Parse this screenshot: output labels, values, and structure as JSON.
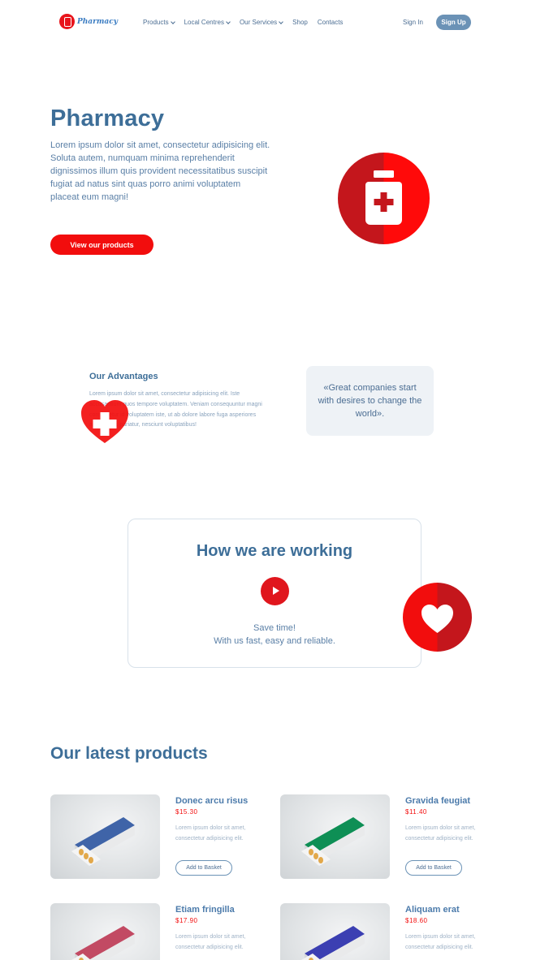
{
  "nav": {
    "logo_text": "Pharmacy",
    "menu": [
      {
        "label": "Products",
        "dropdown": true
      },
      {
        "label": "Local Centres",
        "dropdown": true
      },
      {
        "label": "Our Services",
        "dropdown": true
      },
      {
        "label": "Shop",
        "dropdown": false
      },
      {
        "label": "Contacts",
        "dropdown": false
      }
    ],
    "sign_in": "Sign In",
    "sign_up": "Sign Up"
  },
  "hero": {
    "title": "Pharmacy",
    "text": "Lorem ipsum dolor sit amet, consectetur adipisicing elit. Soluta autem, numquam minima reprehenderit dignissimos illum quis provident necessitatibus suscipit fugiat ad natus sint quas porro animi voluptatem placeat eum magni!",
    "button": "View our products"
  },
  "advantages": {
    "title": "Our Advantages",
    "text": "Lorem ipsum dolor sit amet, consectetur adipisicing elit. Iste accusantium quos tempore voluptatem. Veniam consequuntur magni consectetur id voluptatem iste, ut ab dolore labore fuga asperiores accusamus pariatur, nesciunt voluptatibus!",
    "quote": "«Great companies start with desires to change the world»."
  },
  "how": {
    "title": "How we are working",
    "line1": "Save time!",
    "line2": "With us fast, easy and reliable."
  },
  "products": {
    "title": "Our latest products",
    "button_label": "Add to Basket",
    "items": [
      {
        "name": "Donec arcu risus",
        "price": "$15.30",
        "desc": "Lorem ipsum dolor sit amet, consectetur adipisicing elit.",
        "box_color": "#3f64a8"
      },
      {
        "name": "Gravida feugiat",
        "price": "$11.40",
        "desc": "Lorem ipsum dolor sit amet, consectetur adipisicing elit.",
        "box_color": "#0e8f55"
      },
      {
        "name": "Etiam fringilla",
        "price": "$17.90",
        "desc": "Lorem ipsum dolor sit amet, consectetur adipisicing elit.",
        "box_color": "#c24a63"
      },
      {
        "name": "Aliquam erat",
        "price": "$18.60",
        "desc": "Lorem ipsum dolor sit amet, consectetur adipisicing elit.",
        "box_color": "#3b3fb2"
      }
    ]
  },
  "colors": {
    "accent_red": "#f20d0d",
    "heading_blue": "#3d6e98"
  }
}
